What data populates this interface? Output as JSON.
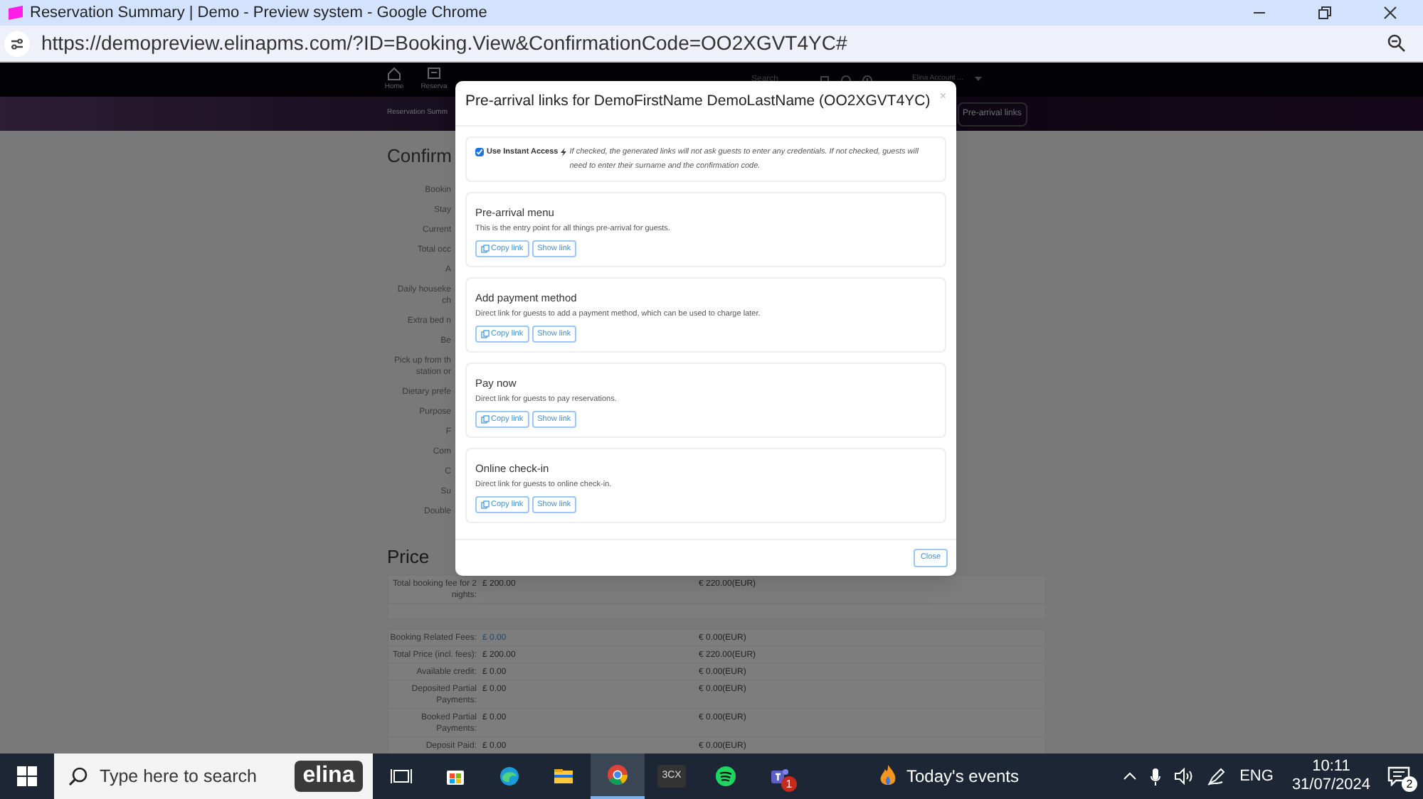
{
  "browser": {
    "title": "Reservation Summary | Demo - Preview system - Google Chrome",
    "url": "https://demopreview.elinapms.com/?ID=Booking.View&ConfirmationCode=OO2XGVT4YC#"
  },
  "app_nav": {
    "items": [
      {
        "label": "Home",
        "kind": "home"
      },
      {
        "label": "Reserva",
        "kind": "reservations"
      }
    ],
    "search_placeholder": "Search",
    "account": "Elina Account ..."
  },
  "subheader": {
    "breadcrumb": "Reservation Summ",
    "action": "Pre-arrival links"
  },
  "page": {
    "heading": "Confirm",
    "labels": [
      "Bookin",
      "Stay",
      "Current",
      "Total occ",
      "A",
      "Daily houseke\nch",
      "Extra bed n",
      "Be",
      "Pick up from th\nstation or",
      "Dietary prefe",
      "Purpose",
      "F",
      "Com",
      "C",
      "Su",
      "Double"
    ],
    "price": {
      "heading": "Price",
      "groups": [
        [
          {
            "label": "Total booking fee for 2 nights:",
            "gbp": "£ 200.00",
            "eur": "€ 220.00(EUR)",
            "kind": "text"
          }
        ],
        [
          {
            "label": "Booking Related Fees:",
            "gbp": "£ 0.00",
            "eur": "€ 0.00(EUR)",
            "kind": "link"
          },
          {
            "label": "Total Price (incl. fees):",
            "gbp": "£ 200.00",
            "eur": "€ 220.00(EUR)",
            "kind": "text"
          },
          {
            "label": "Available credit:",
            "gbp": "£ 0.00",
            "eur": "€ 0.00(EUR)",
            "kind": "text"
          },
          {
            "label": "Deposited Partial Payments:",
            "gbp": "£ 0.00",
            "eur": "€ 0.00(EUR)",
            "kind": "text"
          },
          {
            "label": "Booked Partial Payments:",
            "gbp": "£ 0.00",
            "eur": "€ 0.00(EUR)",
            "kind": "text"
          },
          {
            "label": "Deposit Paid:",
            "gbp": "£ 0.00",
            "eur": "€ 0.00(EUR)",
            "kind": "text"
          }
        ]
      ]
    }
  },
  "modal": {
    "title": "Pre-arrival links for DemoFirstName DemoLastName (OO2XGVT4YC)",
    "close": "×",
    "instant_access": {
      "label": "Use Instant Access",
      "checked": true,
      "note": "If checked, the generated links will not ask guests to enter any credentials. If not checked, guests will need to enter their surname and the confirmation code."
    },
    "sections": [
      {
        "title": "Pre-arrival menu",
        "description": "This is the entry point for all things pre-arrival for guests.",
        "buttons": [
          "Copy link",
          "Show link"
        ]
      },
      {
        "title": "Add payment method",
        "description": "Direct link for guests to add a payment method, which can be used to charge later.",
        "buttons": [
          "Copy link",
          "Show link"
        ]
      },
      {
        "title": "Pay now",
        "description": "Direct link for guests to pay reservations.",
        "buttons": [
          "Copy link",
          "Show link"
        ]
      },
      {
        "title": "Online check-in",
        "description": "Direct link for guests to online check-in.",
        "buttons": [
          "Copy link",
          "Show link"
        ]
      }
    ],
    "footer_button": "Close"
  },
  "taskbar": {
    "search_placeholder": "Type here to search",
    "logo": "elina",
    "apps": [
      {
        "kind": "taskview",
        "selected": false
      },
      {
        "kind": "store",
        "selected": false
      },
      {
        "kind": "edge",
        "selected": false
      },
      {
        "kind": "explorer",
        "selected": false
      },
      {
        "kind": "chrome",
        "selected": true
      },
      {
        "kind": "dialer",
        "label": "3CX",
        "selected": false
      },
      {
        "kind": "spotify",
        "selected": false
      },
      {
        "kind": "teams",
        "badge": "1",
        "selected": false
      }
    ],
    "events": "Today's events",
    "language": "ENG",
    "time": "10:11",
    "date": "31/07/2024",
    "notifications": "2"
  }
}
